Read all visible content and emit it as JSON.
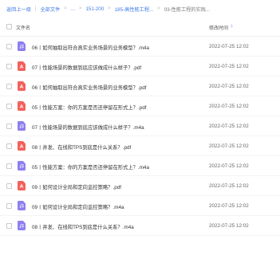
{
  "breadcrumb": [
    {
      "label": "返回上一级",
      "current": false
    },
    {
      "label": "全部文件",
      "current": false
    },
    {
      "label": "...",
      "current": false
    },
    {
      "label": "151-200",
      "current": false
    },
    {
      "label": "185-高性能工程...",
      "current": false
    },
    {
      "label": "03-性能工程的实践...",
      "current": false
    }
  ],
  "header": {
    "name_label": "文件名",
    "time_label": "修改时间",
    "sort_icon": "arrow-down-icon"
  },
  "files": [
    {
      "name": "06丨如何抽取出符合真实业务场景的业务模型？.m4a",
      "type": "m4a",
      "time": "2022-07-25 12:02"
    },
    {
      "name": "07丨性能场景的数据到底应该做成什么样子？.pdf",
      "type": "pdf",
      "time": "2022-07-25 12:02"
    },
    {
      "name": "06丨如何抽取出符合真实业务场景的业务模型？.pdf",
      "type": "pdf",
      "time": "2022-07-25 12:02"
    },
    {
      "name": "05丨性能方案：你的方案是否还停留在形式上？.pdf",
      "type": "pdf",
      "time": "2022-07-25 12:02"
    },
    {
      "name": "07丨性能场景的数据到底应该做成什么样子？.m4a",
      "type": "m4a",
      "time": "2022-07-25 12:02"
    },
    {
      "name": "08丨并发、在线和TPS到底是什么关系？.pdf",
      "type": "pdf",
      "time": "2022-07-25 12:02"
    },
    {
      "name": "05丨性能方案：你的方案是否还停留在形式上？.m4a",
      "type": "m4a",
      "time": "2022-07-25 12:02"
    },
    {
      "name": "09丨如何设计全局和定向监控策略？.pdf",
      "type": "pdf",
      "time": "2022-07-25 12:02"
    },
    {
      "name": "09丨如何设计全局和定向监控策略？.m4a",
      "type": "m4a",
      "time": "2022-07-25 12:02"
    },
    {
      "name": "08丨并发、在线和TPS到底是什么关系？.m4a",
      "type": "m4a",
      "time": "2022-07-25 12:02"
    }
  ],
  "colors": {
    "link": "#3f7ae8",
    "audio_icon": "#8d7ff0",
    "pdf_icon": "#f2625c"
  }
}
